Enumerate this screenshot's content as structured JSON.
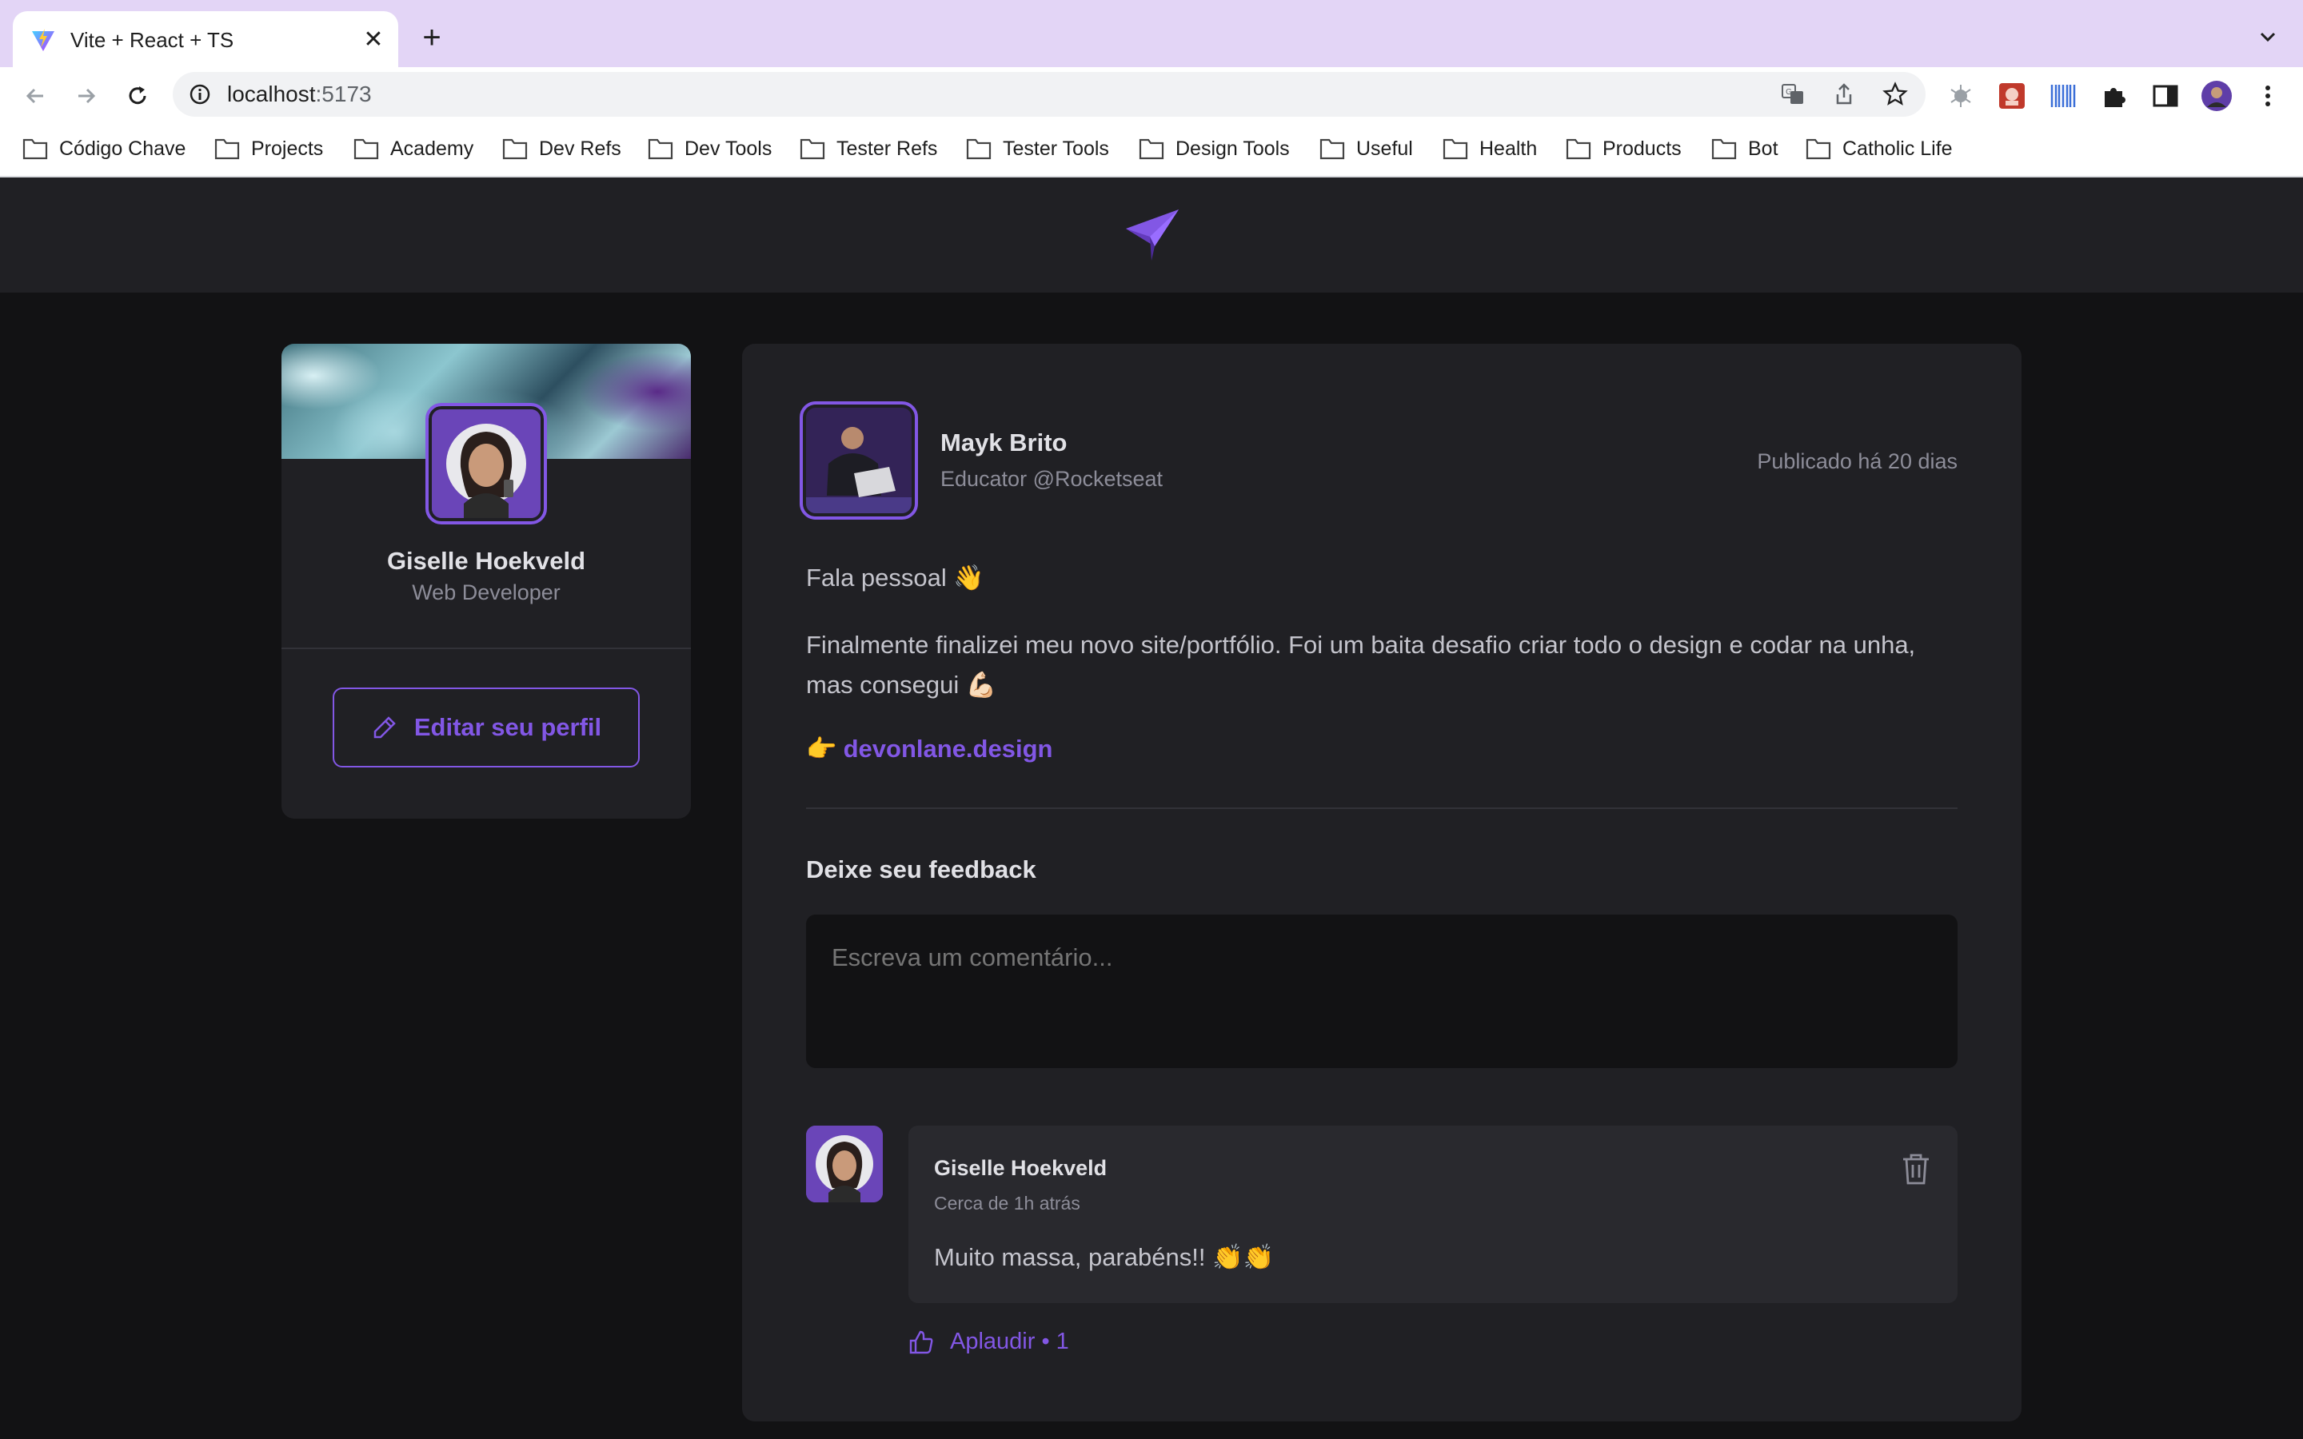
{
  "browser": {
    "tab_title": "Vite + React + TS",
    "url_host": "localhost",
    "url_port": ":5173",
    "bookmarks": [
      "Código Chave",
      "Projects",
      "Academy",
      "Dev Refs",
      "Dev Tools",
      "Tester Refs",
      "Tester Tools",
      "Design Tools",
      "Useful",
      "Health",
      "Products",
      "Bot",
      "Catholic Life"
    ]
  },
  "sidebar": {
    "name": "Giselle Hoekveld",
    "role": "Web Developer",
    "edit_label": "Editar seu perfil"
  },
  "post": {
    "author_name": "Mayk Brito",
    "author_role": "Educator @Rocketseat",
    "published": "Publicado há 20 dias",
    "paragraph_1": "Fala pessoal 👋",
    "paragraph_2": "Finalmente finalizei meu novo site/portfólio. Foi um baita desafio criar todo o design e codar na unha, mas consegui 💪🏻",
    "link_emoji": "👉",
    "link_text": "devonlane.design",
    "feedback_title": "Deixe seu feedback",
    "comment_placeholder": "Escreva um comentário..."
  },
  "comment": {
    "author": "Giselle Hoekveld",
    "time": "Cerca de 1h atrás",
    "text": "Muito massa, parabéns!! 👏👏",
    "applaud": "Aplaudir • 1"
  },
  "colors": {
    "accent": "#8257e5",
    "background": "#121214",
    "card": "#202024"
  }
}
